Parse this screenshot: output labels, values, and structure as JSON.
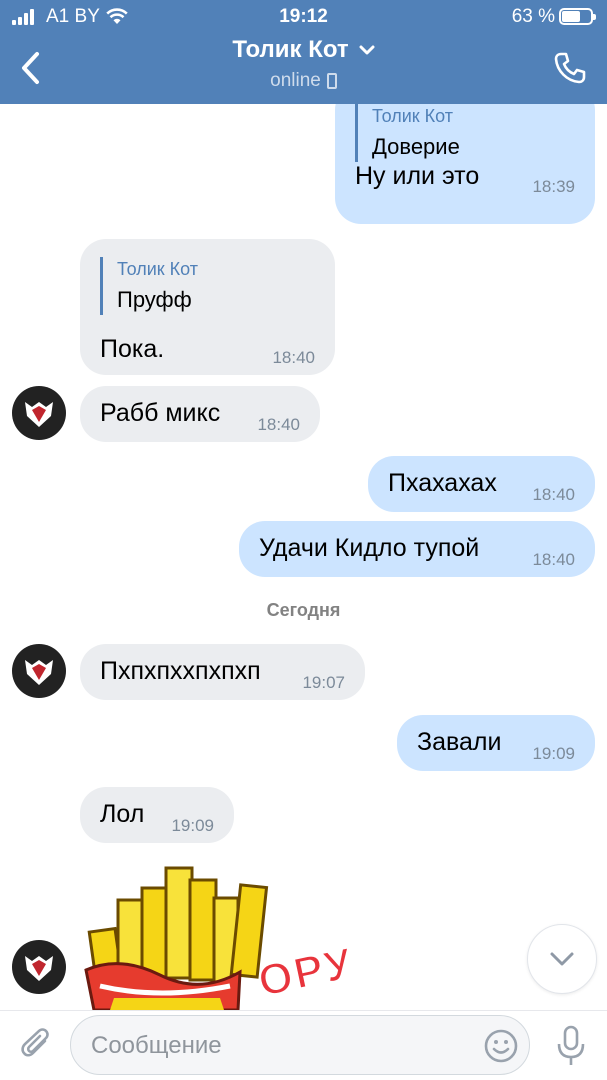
{
  "status_bar": {
    "carrier": "A1 BY",
    "time": "19:12",
    "battery": "63 %"
  },
  "header": {
    "name": "Толик Кот",
    "presence": "online"
  },
  "messages": [
    {
      "dir": "out",
      "quote_name": "Толик Кот",
      "quote_text": "Доверие",
      "text": "Ну или это",
      "time": "18:39"
    },
    {
      "dir": "in",
      "quote_name": "Толик Кот",
      "quote_text": "Пруфф",
      "text": "Пока.",
      "time": "18:40"
    },
    {
      "dir": "in",
      "text": "Рабб микс",
      "time": "18:40"
    },
    {
      "dir": "out",
      "text": "Пхахахах",
      "time": "18:40"
    },
    {
      "dir": "out",
      "text": "Удачи Кидло тупой",
      "time": "18:40"
    },
    {
      "dir": "in",
      "text": "Пхпхпххпхпхп",
      "time": "19:07"
    },
    {
      "dir": "out",
      "text": "Завали",
      "time": "19:09"
    },
    {
      "dir": "in",
      "text": "Лол",
      "time": "19:09"
    }
  ],
  "day_separator": "Сегодня",
  "sticker": {
    "caption": "ОРУ"
  },
  "composer": {
    "placeholder": "Сообщение"
  },
  "colors": {
    "header": "#5181b8",
    "outgoing": "#cce4ff",
    "incoming": "#ebedf0"
  },
  "icons": [
    "back-chevron-icon",
    "phone-icon",
    "attach-icon",
    "emoji-icon",
    "mic-icon",
    "chevron-down-icon"
  ]
}
